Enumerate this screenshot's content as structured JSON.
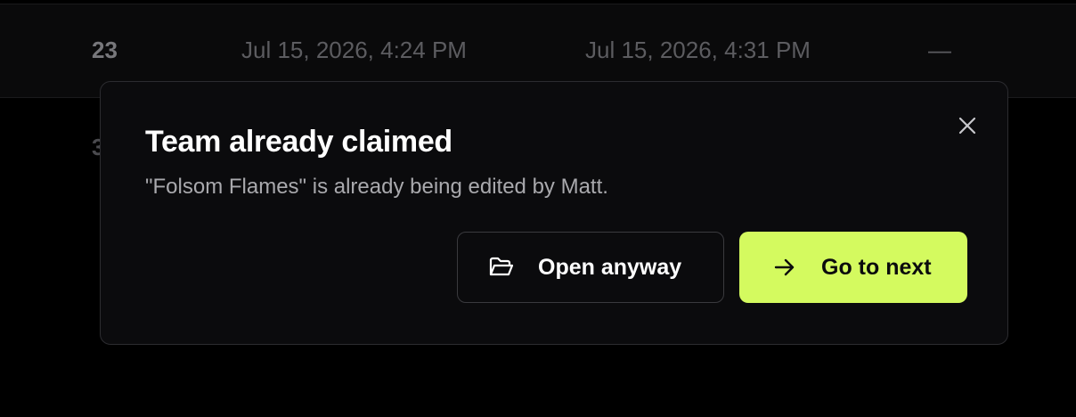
{
  "table": {
    "row": {
      "id": "23",
      "created": "Jul 15, 2026, 4:24 PM",
      "updated": "Jul 15, 2026, 4:31 PM",
      "status": "—"
    },
    "next_row_stub": "3"
  },
  "dialog": {
    "title": "Team already claimed",
    "message": "\"Folsom Flames\" is already being edited by Matt.",
    "close_icon": "close-icon",
    "secondary_button": {
      "label": "Open anyway",
      "icon": "folder-open-icon"
    },
    "primary_button": {
      "label": "Go to next",
      "icon": "arrow-right-icon"
    }
  },
  "colors": {
    "accent": "#d4fa5f",
    "dialog_background": "#0b0b0d",
    "page_background": "#000000"
  }
}
